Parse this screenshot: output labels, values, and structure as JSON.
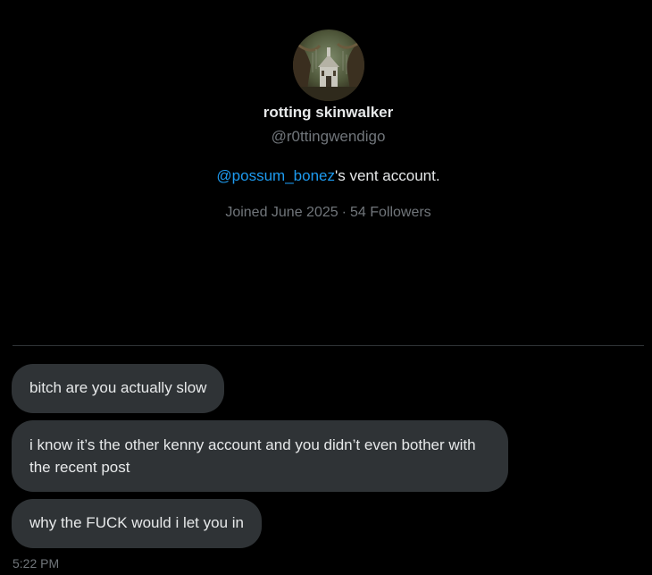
{
  "profile": {
    "avatar_alt": "avatar",
    "display_name": "rotting skinwalker",
    "handle": "@r0ttingwendigo",
    "bio": {
      "mention": "@possum_bonez",
      "rest": "'s vent account."
    },
    "joined": "Joined June 2025",
    "separator": "·",
    "followers": "54 Followers"
  },
  "messages": [
    {
      "text": "bitch are you actually slow"
    },
    {
      "text": "i know it’s the other kenny account and you didn’t even bother with the recent post"
    },
    {
      "text": "why the FUCK would i let you in"
    }
  ],
  "last_timestamp": "5:22 PM",
  "colors": {
    "background": "#000000",
    "bubble": "#2f3336",
    "text": "#e7e9ea",
    "muted": "#71767b",
    "link": "#1d9bf0"
  }
}
